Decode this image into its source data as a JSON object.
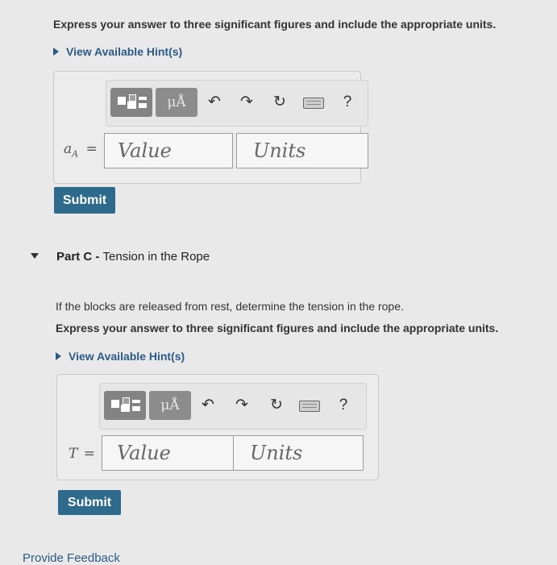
{
  "part_b": {
    "instruction": "Express your answer to three significant figures and include the appropriate units.",
    "hint_label": "View Available Hint(s)",
    "variable_main": "a",
    "variable_sub": "A",
    "equals": "=",
    "value_placeholder": "Value",
    "units_placeholder": "Units",
    "submit_label": "Submit"
  },
  "toolbar": {
    "mu_label": "μÅ",
    "help_label": "?",
    "icons": [
      "templates-icon",
      "units-icon",
      "undo-icon",
      "redo-icon",
      "reset-icon",
      "keyboard-icon",
      "help-icon"
    ]
  },
  "part_c": {
    "label_bold": "Part C",
    "label_separator": " - ",
    "label_title": "Tension in the Rope",
    "question": "If the blocks are released from rest, determine the tension in the rope.",
    "instruction": "Express your answer to three significant figures and include the appropriate units.",
    "hint_label": "View Available Hint(s)",
    "variable": "T",
    "equals": "=",
    "value_placeholder": "Value",
    "units_placeholder": "Units",
    "submit_label": "Submit"
  },
  "footer": {
    "feedback_link": "Provide Feedback"
  },
  "colors": {
    "background": "#e9e9ea",
    "submit": "#2e6a8c",
    "hint_link": "#2c5a86"
  }
}
